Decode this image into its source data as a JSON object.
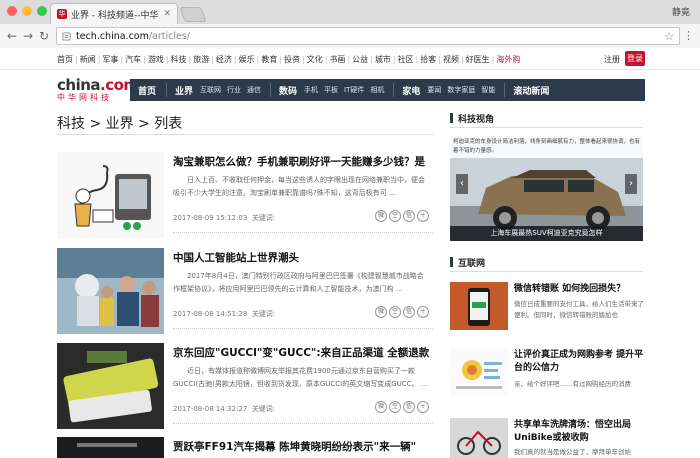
{
  "browser": {
    "tab_title": "业界 - 科技频道--中华网",
    "profile": "静竟",
    "url_host": "tech.china.com",
    "url_path": "/articles/"
  },
  "topnav": {
    "links": [
      "首页",
      "新闻",
      "军事",
      "汽车",
      "游戏",
      "科技",
      "旅游",
      "经济",
      "娱乐",
      "教育",
      "投资",
      "文化",
      "书画",
      "公益",
      "城市",
      "社区",
      "拾客",
      "视频",
      "好医生"
    ],
    "overseas": "海外购",
    "register": "注册",
    "login": "登录"
  },
  "logo": {
    "line1a": "china",
    "line1b": ".com",
    "line2": "中华网科技"
  },
  "channel": {
    "groups": [
      {
        "big": "首页",
        "subs": []
      },
      {
        "big": "业界",
        "subs": [
          "互联网",
          "行业",
          "通信"
        ]
      },
      {
        "big": "数码",
        "subs": [
          "手机",
          "平板",
          "IT硬件",
          "相机"
        ]
      },
      {
        "big": "家电",
        "subs": [
          "要闻",
          "数字家庭",
          "智能"
        ]
      },
      {
        "big": "滚动新闻",
        "subs": []
      }
    ]
  },
  "breadcrumb": "科技 > 业界 > 列表",
  "articles": [
    {
      "title": "淘宝兼职怎么做？手机兼职刷好评一天能赚多少钱？是",
      "summary": "日入上百、不收取任何押金，每当这些诱人的字眼出现在网络兼职当中，便会吸引不少大学生的注意。淘宝刷单兼职靠谱吗?殊不知，这背后极有可 ...",
      "date": "2017-08-09 15:12:03",
      "kw": "关键词:"
    },
    {
      "title": "中国人工智能站上世界潮头",
      "summary": "2017年8月4日，澳门特别行政区政府与阿里巴巴签署《构建智慧城市战略合作框架协议》，将应用阿里巴巴领先的云计算和人工智能技术，为澳门构 ...",
      "date": "2017-08-08 14:51:28",
      "kw": "关键词:"
    },
    {
      "title": "京东回应\"GUCCI\"变\"GUCC\":来自正品渠道 全额退款",
      "summary": "近日，有媒体报道称微博网友举报其花费1900元通过京东自营购买了一款GUCCI(古驰)男款太阳镜，但收到货发现，原本GUCCI的英文缩写变成GUCC。 ...",
      "date": "2017-08-08 14:32:27",
      "kw": "关键词:"
    },
    {
      "title": "贾跃亭FF91汽车揭幕 陈坤黄晓明纷纷表示\"来一辆\"",
      "summary": "",
      "date": "",
      "kw": ""
    }
  ],
  "sidebar": {
    "tech_heading": "科技视角",
    "feature_caption": "柯迪亚克的车身设计简洁利落，线条刻画细腻有力，整体看起来很协调，也有着不错的力量感。",
    "feature_title": "上海车展最热SUV柯迪亚克究竟怎样",
    "net_heading": "互联网",
    "items": [
      {
        "title": "微信转错账 如何挽回损失？",
        "summary": "微信已成重要的支付工具，给人们生活带来了便利。但同时，微信转错账的尴尬也"
      },
      {
        "title": "让评价真正成为网购参考 提升平台的公信力",
        "summary": "亲，给个好评吧……有过网购经历的消费"
      },
      {
        "title": "共享单车洗牌清场：悟空出局 UniBike或被收购",
        "summary": "我们真的就当是做公益了，摩拜单车创始"
      }
    ]
  }
}
